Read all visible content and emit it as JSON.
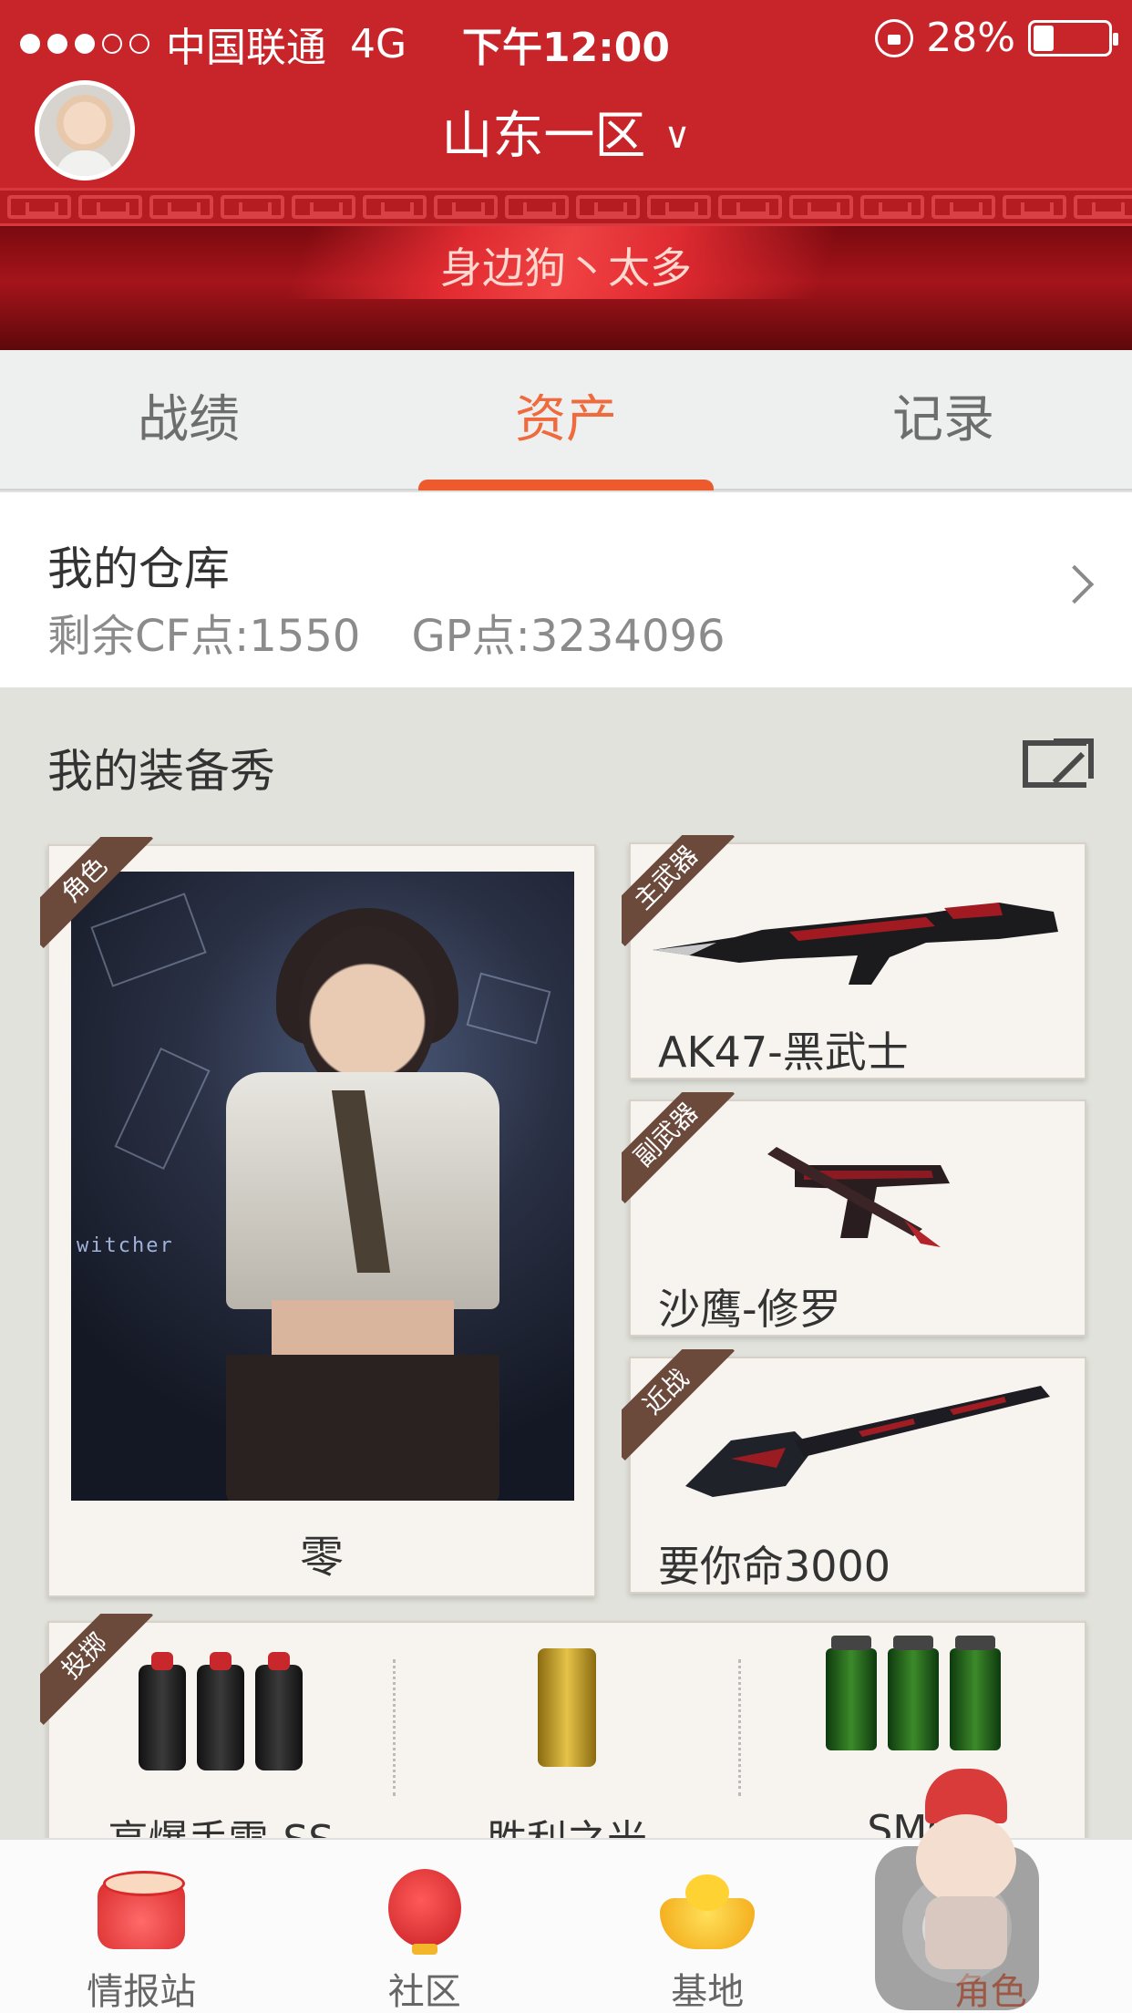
{
  "status": {
    "carrier": "中国联通",
    "network": "4G",
    "time": "下午12:00",
    "battery": "28%",
    "battery_level": 0.28,
    "signal_bars": 3
  },
  "header": {
    "server": "山东一区",
    "banner_title": "身边狗丶太多"
  },
  "tabs": [
    {
      "label": "战绩",
      "active": false
    },
    {
      "label": "资产",
      "active": true
    },
    {
      "label": "记录",
      "active": false
    }
  ],
  "warehouse": {
    "title": "我的仓库",
    "cf_points": "剩余CF点:1550",
    "gp_points": "GP点:3234096"
  },
  "equipment": {
    "title": "我的装备秀",
    "character": {
      "badge": "角色",
      "name": "零",
      "image_tag": "witcher"
    },
    "weapons": [
      {
        "badge": "主武器",
        "name": "AK47-黑武士"
      },
      {
        "badge": "副武器",
        "name": "沙鹰-修罗"
      },
      {
        "badge": "近战",
        "name": "要你命3000"
      }
    ],
    "throwables": {
      "badge": "投掷",
      "items": [
        {
          "name": "高爆手雷-SS"
        },
        {
          "name": "胜利之光"
        },
        {
          "name": "SMO"
        }
      ]
    }
  },
  "bottom_nav": [
    {
      "label": "情报站",
      "icon": "drum-icon",
      "active": false
    },
    {
      "label": "社区",
      "icon": "lantern-icon",
      "active": false
    },
    {
      "label": "基地",
      "icon": "gold-ingot-icon",
      "active": false
    },
    {
      "label": "角色",
      "icon": "mascot-icon",
      "active": true
    }
  ],
  "colors": {
    "header_red": "#c8252a",
    "accent_orange": "#ec5a2d",
    "badge_brown": "#6b4a3c",
    "background": "#e2e2dc"
  }
}
